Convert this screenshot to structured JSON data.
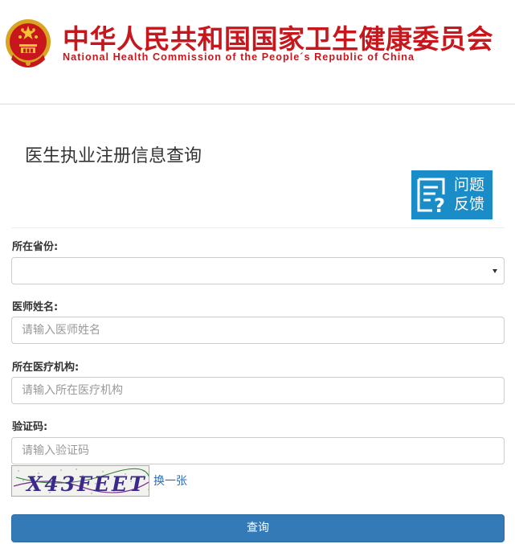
{
  "header": {
    "org_name_cn": "中华人民共和国国家卫生健康委员会",
    "org_name_en": "National Health Commission of the People´s Republic of China",
    "brand_color": "#c8161d"
  },
  "page": {
    "title": "医生执业注册信息查询"
  },
  "feedback": {
    "line1": "问题",
    "line2": "反馈",
    "color": "#1a8cc7"
  },
  "form": {
    "province": {
      "label": "所在省份:",
      "value": ""
    },
    "doctor_name": {
      "label": "医师姓名:",
      "placeholder": "请输入医师姓名",
      "value": ""
    },
    "institution": {
      "label": "所在医疗机构:",
      "placeholder": "请输入所在医疗机构",
      "value": ""
    },
    "captcha": {
      "label": "验证码:",
      "placeholder": "请输入验证码",
      "value": "",
      "image_text": "X43FEET",
      "refresh_label": "换一张"
    },
    "submit_label": "查询",
    "submit_color": "#337ab7"
  }
}
